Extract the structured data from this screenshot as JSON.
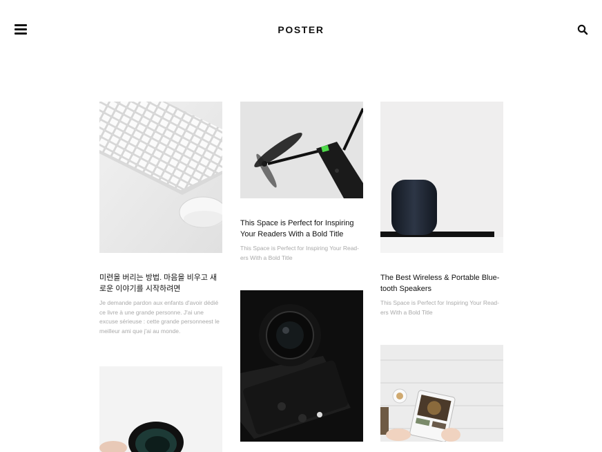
{
  "header": {
    "site_title": "POSTER",
    "menu_icon": "hamburger-menu-icon",
    "search_icon": "search-icon"
  },
  "posts": [
    {
      "image": "keyboard-and-mouse-photo",
      "title": "미련을 버리는 방법. 마음을 비우고 새로운 이야기를 시작하려면",
      "excerpt": "Je demande pardon aux enfants d'avoir dédié ce livre à une grande personne. J'ai une excuse sérieuse : cette grande personneest le meilleur ami que j'ai au monde."
    },
    {
      "image": "drone-photo",
      "title": "This Space is Perfect for Inspiring Your Readers With a Bold Title",
      "excerpt": "This Space is Perfect for Inspiring Your Read- ers With a Bold Title"
    },
    {
      "image": "smart-speaker-photo",
      "title": "The Best Wireless & Portable Blue- tooth Speakers",
      "excerpt": "This Space is Perfect for Inspiring Your Read- ers With a Bold Title"
    },
    {
      "image": "camera-lens-photo"
    },
    {
      "image": "black-camera-photo"
    },
    {
      "image": "tablet-on-table-photo"
    }
  ]
}
